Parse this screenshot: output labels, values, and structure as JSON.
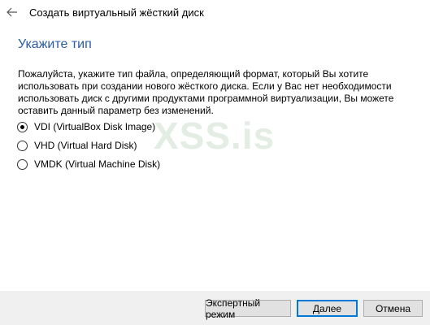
{
  "window": {
    "title": "Создать виртуальный жёсткий диск",
    "back_icon": "arrow-left-icon"
  },
  "page": {
    "heading": "Укажите тип",
    "description": "Пожалуйста, укажите тип файла, определяющий формат, который Вы хотите использовать при создании нового жёсткого диска. Если у Вас нет необходимости использовать диск с другими продуктами программной виртуализации, Вы можете оставить данный параметр без изменений."
  },
  "options": [
    {
      "label": "VDI (VirtualBox Disk Image)",
      "checked": true
    },
    {
      "label": "VHD (Virtual Hard Disk)",
      "checked": false
    },
    {
      "label": "VMDK (Virtual Machine Disk)",
      "checked": false
    }
  ],
  "watermark": "XSS.is",
  "buttons": {
    "expert_label": "Экспертный режим",
    "next_label": "Далее",
    "cancel_label": "Отмена"
  },
  "colors": {
    "heading": "#2b5ba3",
    "default_button_border": "#0078d7",
    "footer_bg": "#f0f0f0"
  }
}
